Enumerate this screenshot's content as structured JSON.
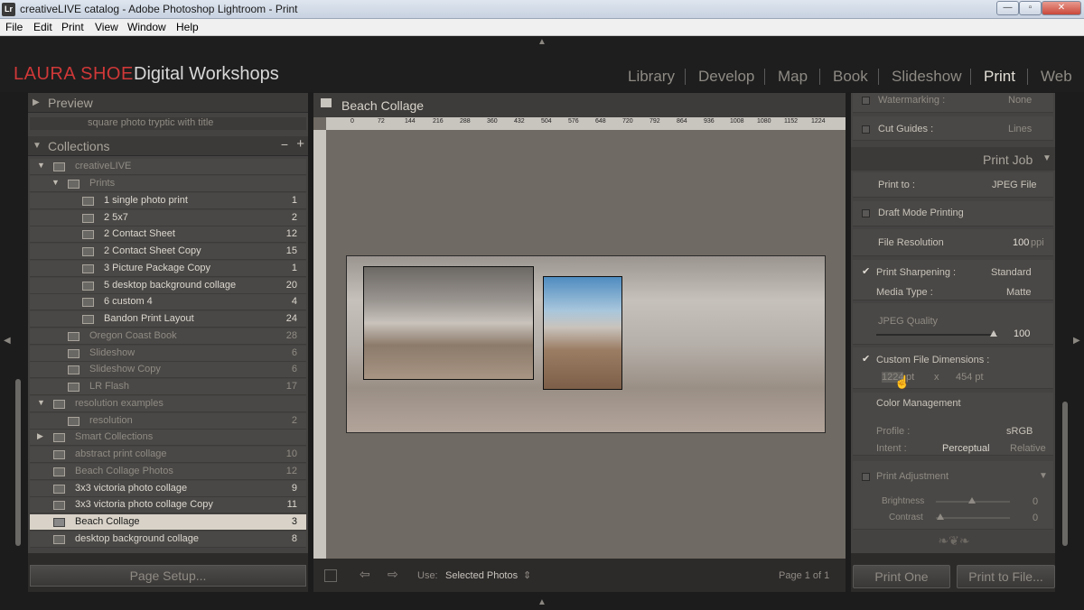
{
  "window": {
    "title": "creativeLIVE catalog - Adobe Photoshop Lightroom - Print",
    "app_icon": "Lr"
  },
  "menu": [
    "File",
    "Edit",
    "Print",
    "View",
    "Window",
    "Help"
  ],
  "brand": {
    "part1": "LAURA SHOE",
    "part2": "Digital Workshops",
    "color": "#d03838"
  },
  "modules": [
    "Library",
    "Develop",
    "Map",
    "Book",
    "Slideshow",
    "Print",
    "Web"
  ],
  "active_module": "Print",
  "left": {
    "preview_label": "Preview",
    "template_item": "square photo tryptic with title",
    "collections_label": "Collections",
    "items": [
      {
        "label": "creativeLIVE",
        "count": ""
      },
      {
        "label": "Prints",
        "count": ""
      },
      {
        "label": "1 single photo print",
        "count": "1"
      },
      {
        "label": "2 5x7",
        "count": "2"
      },
      {
        "label": "2 Contact Sheet",
        "count": "12"
      },
      {
        "label": "2 Contact Sheet Copy",
        "count": "15"
      },
      {
        "label": "3 Picture Package Copy",
        "count": "1"
      },
      {
        "label": "5 desktop background collage",
        "count": "20"
      },
      {
        "label": "6 custom 4",
        "count": "4"
      },
      {
        "label": "Bandon Print Layout",
        "count": "24"
      },
      {
        "label": "Oregon Coast Book",
        "count": "28"
      },
      {
        "label": "Slideshow",
        "count": "6"
      },
      {
        "label": "Slideshow Copy",
        "count": "6"
      },
      {
        "label": "LR Flash",
        "count": "17"
      },
      {
        "label": "resolution examples",
        "count": ""
      },
      {
        "label": "resolution",
        "count": "2"
      },
      {
        "label": "Smart Collections",
        "count": ""
      },
      {
        "label": "abstract print collage",
        "count": "10"
      },
      {
        "label": "Beach Collage Photos",
        "count": "12"
      },
      {
        "label": "3x3 victoria photo collage",
        "count": "9"
      },
      {
        "label": "3x3 victoria photo collage Copy",
        "count": "11"
      },
      {
        "label": "Beach Collage",
        "count": "3"
      },
      {
        "label": "desktop background collage",
        "count": "8"
      }
    ],
    "page_setup": "Page Setup..."
  },
  "center": {
    "title": "Beach Collage",
    "ruler": [
      "0",
      "72",
      "144",
      "216",
      "288",
      "360",
      "432",
      "504",
      "576",
      "648",
      "720",
      "792",
      "864",
      "936",
      "1008",
      "1080",
      "1152",
      "1224"
    ],
    "use_label": "Use:",
    "use_value": "Selected Photos",
    "page_info": "Page 1 of 1"
  },
  "right": {
    "watermarking": "Watermarking :",
    "watermark_value": "None",
    "cut_guides": "Cut Guides :",
    "cut_guides_value": "Lines",
    "print_job": "Print Job",
    "print_to_label": "Print to :",
    "print_to_value": "JPEG File",
    "draft_mode": "Draft Mode Printing",
    "file_resolution_label": "File Resolution",
    "file_resolution_value": "100",
    "file_resolution_unit": "ppi",
    "print_sharpening": "Print Sharpening :",
    "sharpening_value": "Standard",
    "media_type_label": "Media Type :",
    "media_type_value": "Matte",
    "jpeg_quality_label": "JPEG Quality",
    "jpeg_quality_value": "100",
    "custom_dims_label": "Custom File Dimensions :",
    "dim_w": "1224",
    "dim_unit": "pt",
    "dim_x": "x",
    "dim_h": "454 pt",
    "color_mgmt": "Color Management",
    "profile_label": "Profile :",
    "profile_value": "sRGB",
    "intent_label": "Intent :",
    "intent_perceptual": "Perceptual",
    "intent_relative": "Relative",
    "print_adjustment": "Print Adjustment",
    "brightness": "Brightness",
    "contrast": "Contrast",
    "brightness_value": "0",
    "contrast_value": "0",
    "print_one": "Print One",
    "print_to_file": "Print to File..."
  }
}
